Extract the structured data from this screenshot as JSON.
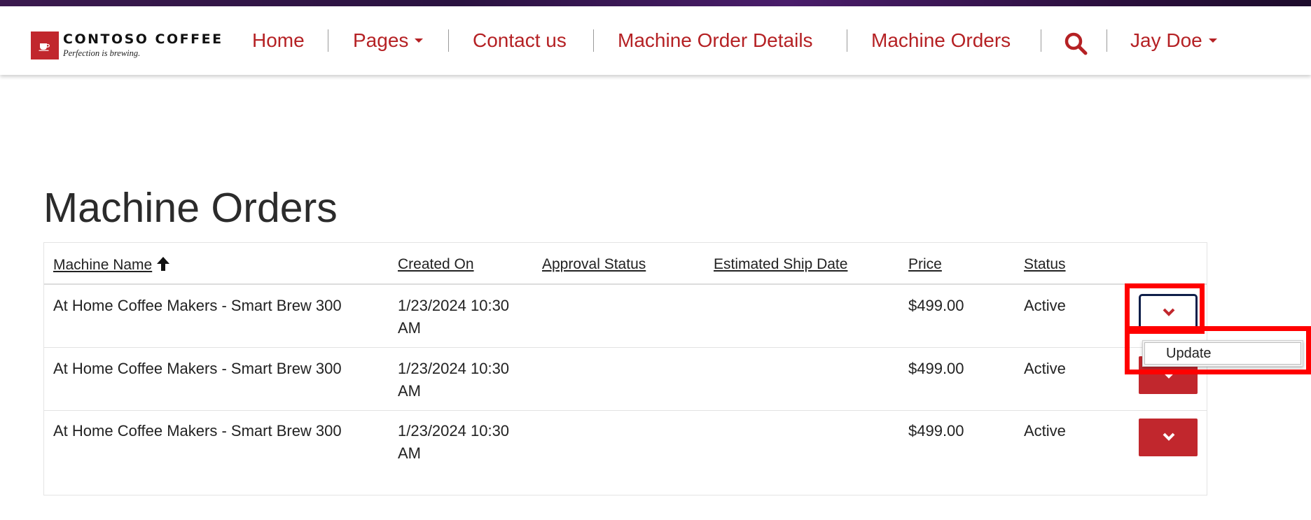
{
  "brand": {
    "name": "CONTOSO COFFEE",
    "tagline": "Perfection is brewing."
  },
  "nav": {
    "home": "Home",
    "pages": "Pages",
    "contact": "Contact us",
    "machine_order_details": "Machine Order Details",
    "machine_orders": "Machine Orders",
    "user": "Jay Doe"
  },
  "page": {
    "title": "Machine Orders"
  },
  "table": {
    "columns": [
      "Machine Name",
      "Created On",
      "Approval Status",
      "Estimated Ship Date",
      "Price",
      "Status"
    ],
    "sort_column": "Machine Name",
    "sort_direction": "ascending",
    "rows": [
      {
        "machine_name": "At Home Coffee Makers - Smart Brew 300",
        "created_on_line1": "1/23/2024 10:30",
        "created_on_line2": "AM",
        "approval_status": "",
        "estimated_ship_date": "",
        "price": "$499.00",
        "status": "Active"
      },
      {
        "machine_name": "At Home Coffee Makers - Smart Brew 300",
        "created_on_line1": "1/23/2024 10:30",
        "created_on_line2": "AM",
        "approval_status": "",
        "estimated_ship_date": "",
        "price": "$499.00",
        "status": "Active"
      },
      {
        "machine_name": "At Home Coffee Makers - Smart Brew 300",
        "created_on_line1": "1/23/2024 10:30",
        "created_on_line2": "AM",
        "approval_status": "",
        "estimated_ship_date": "",
        "price": "$499.00",
        "status": "Active"
      }
    ]
  },
  "row_menu": {
    "items": [
      "Update"
    ]
  },
  "colors": {
    "accent": "#c1272d",
    "nav_text": "#b52124",
    "highlight": "#ff0000"
  },
  "icons": {
    "search": "search-icon",
    "caret": "caret-down-icon",
    "sort": "arrow-up-icon",
    "row_action": "chevron-down-icon"
  }
}
